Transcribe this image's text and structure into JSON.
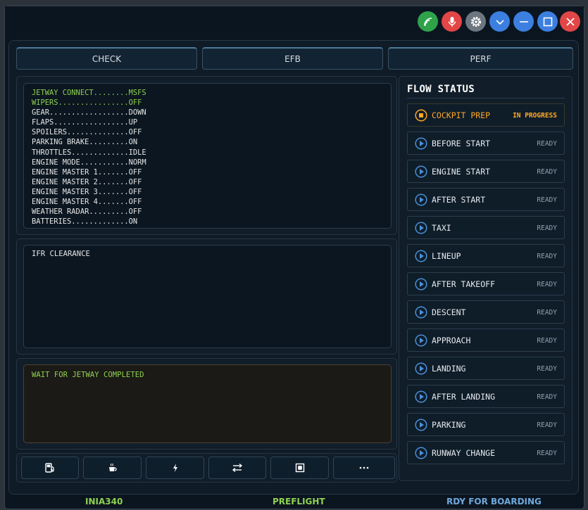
{
  "titlebar": {
    "buttons": [
      {
        "name": "wifi-button",
        "icon": "wifi-icon",
        "color": "#2fa24a"
      },
      {
        "name": "mic-button",
        "icon": "microphone-icon",
        "color": "#e24646"
      },
      {
        "name": "settings-button",
        "icon": "gear-icon",
        "color": "#6b7681"
      },
      {
        "name": "collapse-button",
        "icon": "chevron-down-icon",
        "color": "#3c7fe0"
      },
      {
        "name": "minimize-button",
        "icon": "minimize-icon",
        "color": "#3c7fe0"
      },
      {
        "name": "maximize-button",
        "icon": "maximize-icon",
        "color": "#3c7fe0"
      },
      {
        "name": "close-button",
        "icon": "close-icon",
        "color": "#e24646"
      }
    ]
  },
  "tabs": [
    {
      "label": "CHECK"
    },
    {
      "label": "EFB"
    },
    {
      "label": "PERF"
    }
  ],
  "checklist": [
    {
      "text": "JETWAY CONNECT........MSFS",
      "done": true
    },
    {
      "text": "WIPERS................OFF",
      "done": true
    },
    {
      "text": "GEAR..................DOWN",
      "done": false
    },
    {
      "text": "FLAPS.................UP",
      "done": false
    },
    {
      "text": "SPOILERS..............OFF",
      "done": false
    },
    {
      "text": "PARKING BRAKE.........ON",
      "done": false
    },
    {
      "text": "THROTTLES.............IDLE",
      "done": false
    },
    {
      "text": "ENGINE MODE...........NORM",
      "done": false
    },
    {
      "text": "ENGINE MASTER 1.......OFF",
      "done": false
    },
    {
      "text": "ENGINE MASTER 2.......OFF",
      "done": false
    },
    {
      "text": "ENGINE MASTER 3.......OFF",
      "done": false
    },
    {
      "text": "ENGINE MASTER 4.......OFF",
      "done": false
    },
    {
      "text": "WEATHER RADAR.........OFF",
      "done": false
    },
    {
      "text": "BATTERIES.............ON",
      "done": false
    }
  ],
  "clearance": {
    "text": "IFR CLEARANCE"
  },
  "status_message": {
    "text": "WAIT FOR JETWAY COMPLETED"
  },
  "toolbar": [
    {
      "name": "fuel-button",
      "icon": "fuel-pump-icon"
    },
    {
      "name": "catering-button",
      "icon": "coffee-cup-icon"
    },
    {
      "name": "power-button",
      "icon": "lightning-icon"
    },
    {
      "name": "swap-button",
      "icon": "swap-arrows-icon"
    },
    {
      "name": "stop-button",
      "icon": "stop-square-icon"
    },
    {
      "name": "more-button",
      "icon": "more-dots-icon"
    }
  ],
  "flow": {
    "title": "FLOW STATUS",
    "items": [
      {
        "label": "COCKPIT PREP",
        "state": "IN PROGRESS",
        "active": true
      },
      {
        "label": "BEFORE START",
        "state": "READY",
        "active": false
      },
      {
        "label": "ENGINE START",
        "state": "READY",
        "active": false
      },
      {
        "label": "AFTER START",
        "state": "READY",
        "active": false
      },
      {
        "label": "TAXI",
        "state": "READY",
        "active": false
      },
      {
        "label": "LINEUP",
        "state": "READY",
        "active": false
      },
      {
        "label": "AFTER TAKEOFF",
        "state": "READY",
        "active": false
      },
      {
        "label": "DESCENT",
        "state": "READY",
        "active": false
      },
      {
        "label": "APPROACH",
        "state": "READY",
        "active": false
      },
      {
        "label": "LANDING",
        "state": "READY",
        "active": false
      },
      {
        "label": "AFTER LANDING",
        "state": "READY",
        "active": false
      },
      {
        "label": "PARKING",
        "state": "READY",
        "active": false
      },
      {
        "label": "RUNWAY CHANGE",
        "state": "READY",
        "active": false
      }
    ]
  },
  "statusbar": {
    "aircraft": "INIA340",
    "phase": "PREFLIGHT",
    "boarding": "RDY FOR BOARDING"
  },
  "colors": {
    "done": "#8fd14f",
    "active": "#ffa726",
    "ready_icon": "#4a90d9",
    "aircraft": "#8fd14f",
    "phase": "#8fd14f",
    "boarding": "#6fa8dc"
  }
}
